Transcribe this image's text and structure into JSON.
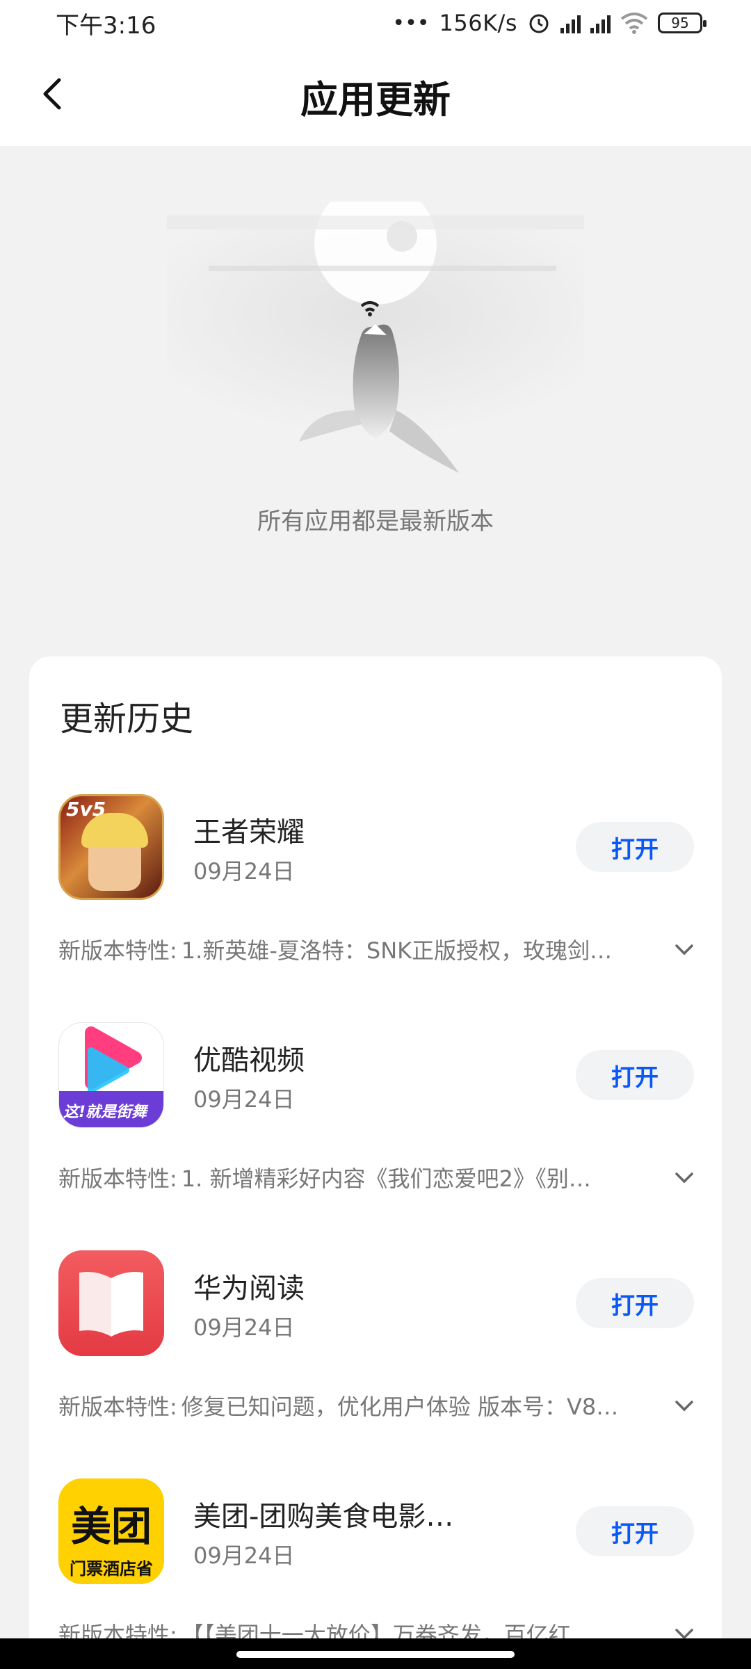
{
  "status_bar": {
    "time": "下午3:16",
    "network_speed": "156K/s",
    "battery": "95",
    "icons": [
      "more-dots-icon",
      "alarm-icon",
      "signal-hd-icon",
      "signal-hd-icon",
      "wifi-icon",
      "battery-icon"
    ]
  },
  "header": {
    "title": "应用更新",
    "back_icon": "chevron-left-icon"
  },
  "empty_state": {
    "message": "所有应用都是最新版本",
    "illustration": "shark-wifi-illustration"
  },
  "history": {
    "title": "更新历史",
    "items": [
      {
        "name": "王者荣耀",
        "date": "09月24日",
        "open_label": "打开",
        "release_label": "新版本特性:",
        "release_text": "1.新英雄-夏洛特：SNK正版授权，玫瑰剑…",
        "icon": "honor-of-kings-icon",
        "icon_text": "5v5"
      },
      {
        "name": "优酷视频",
        "date": "09月24日",
        "open_label": "打开",
        "release_label": "新版本特性:",
        "release_text": "1. 新增精彩好内容《我们恋爱吧2》《别…",
        "icon": "youku-icon",
        "icon_text": "这!就是街舞"
      },
      {
        "name": "华为阅读",
        "date": "09月24日",
        "open_label": "打开",
        "release_label": "新版本特性:",
        "release_text": "修复已知问题，优化用户体验 版本号：V8…",
        "icon": "huawei-books-icon"
      },
      {
        "name": "美团-团购美食电影…",
        "date": "09月24日",
        "open_label": "打开",
        "release_label": "新版本特性:",
        "release_text": "【【美团十一大放价】万券齐发，百亿红…",
        "icon": "meituan-icon",
        "icon_text": "美团",
        "icon_subtext": "门票酒店省"
      }
    ]
  },
  "colors": {
    "accent": "#0a59f7",
    "background": "#f2f2f2",
    "card": "#ffffff",
    "meituan_yellow": "#ffd100",
    "huawei_red": "#ef4a50"
  }
}
